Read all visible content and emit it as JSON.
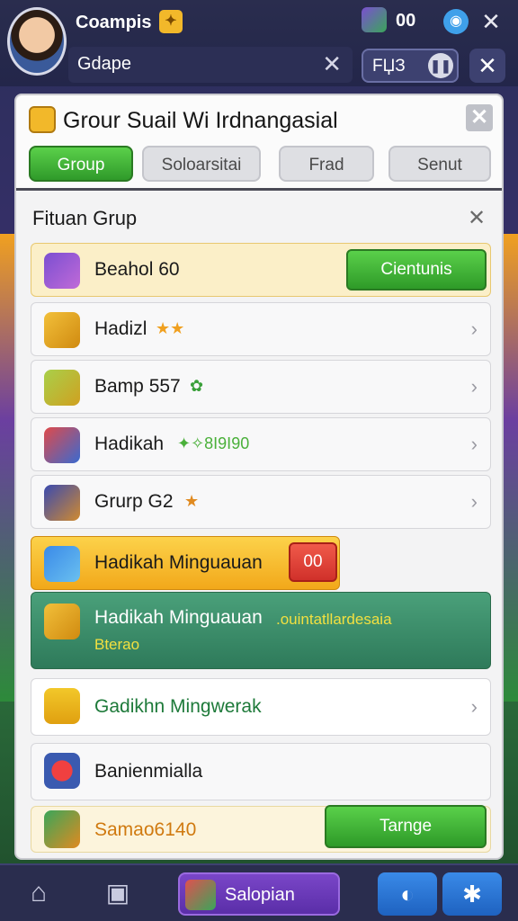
{
  "header": {
    "player_name": "Coampis",
    "gem_count": "00",
    "group_field": "Gdape",
    "code": "FЏЗ"
  },
  "panel": {
    "title": "Grour Suail Wi Irdnangasial",
    "tabs": [
      {
        "label": "Group",
        "active": true
      },
      {
        "label": "Soloarsitai",
        "active": false
      },
      {
        "label": "Frad",
        "active": false
      },
      {
        "label": "Senut",
        "active": false
      }
    ],
    "section_title": "Fituan Grup",
    "rows": [
      {
        "label": "Beahol 60",
        "button": "Cientunis",
        "icon": "puzzle-icon"
      },
      {
        "label": "Hadizl",
        "extra": "★★",
        "icon": "gift-icon"
      },
      {
        "label": "Bamp 557",
        "extra": "✿",
        "icon": "box-icon"
      },
      {
        "label": "Hadikah",
        "extra": "✦✧8I9I90",
        "icon": "shop-icon"
      },
      {
        "label": "Grurp G2",
        "extra": "★",
        "icon": "tool-icon"
      },
      {
        "label": "Hadikah Minguauan",
        "badge": "00",
        "icon": "ticket-icon"
      },
      {
        "label": "Hadikah Minguauan",
        "highlight": ".ouintatllardesaia",
        "sub": "Bterao",
        "icon": "chest-icon"
      },
      {
        "label": "Gadikhn Mingwerak",
        "icon": "orb-icon"
      },
      {
        "label": "Banienmialla",
        "icon": "ball-icon"
      },
      {
        "label": "Samao6140",
        "button": "Tarnge",
        "icon": "crate-icon"
      }
    ]
  },
  "bottom_nav": {
    "active_label": "Salopian"
  },
  "colors": {
    "accent_green": "#2f9a2a",
    "accent_red": "#d0302a",
    "accent_purple": "#5a2ea8",
    "accent_blue": "#1e62c0"
  }
}
